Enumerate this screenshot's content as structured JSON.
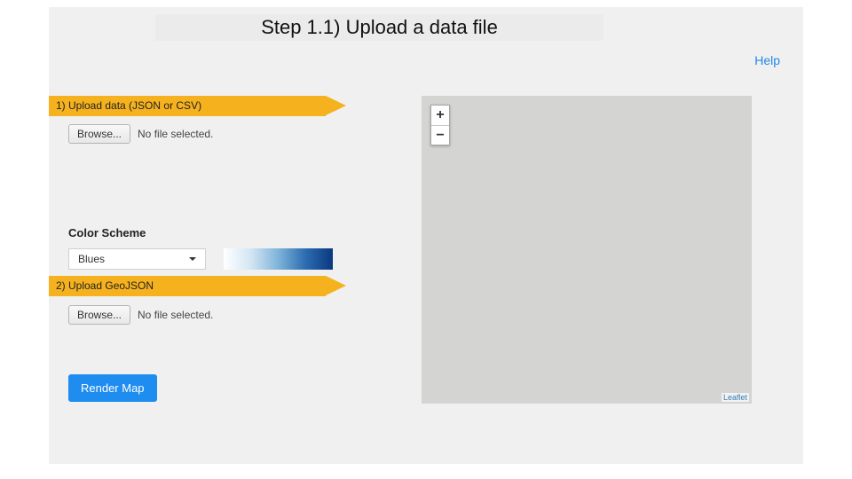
{
  "title": "Step 1.1) Upload a data file",
  "help_label": "Help",
  "steps": {
    "upload_data": {
      "ribbon": "1) Upload data (JSON or CSV)",
      "browse_label": "Browse...",
      "file_status": "No file selected."
    },
    "upload_geojson": {
      "ribbon": "2) Upload GeoJSON",
      "browse_label": "Browse...",
      "file_status": "No file selected."
    }
  },
  "color_scheme": {
    "label": "Color Scheme",
    "selected": "Blues"
  },
  "render_label": "Render Map",
  "map": {
    "zoom_in": "+",
    "zoom_out": "−",
    "attribution": "Leaflet"
  }
}
